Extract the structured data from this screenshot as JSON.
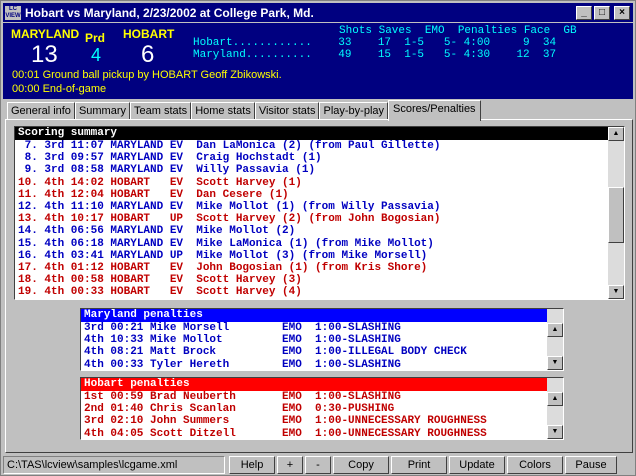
{
  "window": {
    "title": "Hobart vs Maryland, 2/23/2002 at College Park, Md.",
    "icon_text": "LC VIEW",
    "controls": [
      "_",
      "□",
      "×"
    ]
  },
  "scoreboard": {
    "home": {
      "name": "MARYLAND",
      "score": "13"
    },
    "visitor": {
      "name": "HOBART",
      "score": "6"
    },
    "period_label": "Prd",
    "period": "4",
    "stats_header": "Shots Saves  EMO  Penalties Face  GB",
    "stats_rows": [
      "Hobart............    33    17  1-5   5- 4:00     9  34",
      "Maryland..........    49    15  1-5   5- 4:30    12  37"
    ],
    "play_lines": [
      "00:01  Ground ball pickup by HOBART Geoff Zbikowski.",
      "00:00  End-of-game"
    ]
  },
  "tabs": [
    {
      "label": "General info",
      "active": false
    },
    {
      "label": "Summary",
      "active": false
    },
    {
      "label": "Team stats",
      "active": false
    },
    {
      "label": "Home stats",
      "active": false
    },
    {
      "label": "Visitor stats",
      "active": false
    },
    {
      "label": "Play-by-play",
      "active": false
    },
    {
      "label": "Scores/Penalties",
      "active": true
    }
  ],
  "scoring": {
    "header": "Scoring summary",
    "rows": [
      {
        "text": " 7. 3rd 11:07 MARYLAND EV  Dan LaMonica (2) (from Paul Gillette)",
        "team": "blue"
      },
      {
        "text": " 8. 3rd 09:57 MARYLAND EV  Craig Hochstadt (1)",
        "team": "blue"
      },
      {
        "text": " 9. 3rd 08:58 MARYLAND EV  Willy Passavia (1)",
        "team": "blue"
      },
      {
        "text": "10. 4th 14:02 HOBART   EV  Scott Harvey (1)",
        "team": "red"
      },
      {
        "text": "11. 4th 12:04 HOBART   EV  Dan Cesere (1)",
        "team": "red"
      },
      {
        "text": "12. 4th 11:10 MARYLAND EV  Mike Mollot (1) (from Willy Passavia)",
        "team": "blue"
      },
      {
        "text": "13. 4th 10:17 HOBART   UP  Scott Harvey (2) (from John Bogosian)",
        "team": "red"
      },
      {
        "text": "14. 4th 06:56 MARYLAND EV  Mike Mollot (2)",
        "team": "blue"
      },
      {
        "text": "15. 4th 06:18 MARYLAND EV  Mike LaMonica (1) (from Mike Mollot)",
        "team": "blue"
      },
      {
        "text": "16. 4th 03:41 MARYLAND UP  Mike Mollot (3) (from Mike Morsell)",
        "team": "blue"
      },
      {
        "text": "17. 4th 01:12 HOBART   EV  John Bogosian (1) (from Kris Shore)",
        "team": "red"
      },
      {
        "text": "18. 4th 00:58 HOBART   EV  Scott Harvey (3)",
        "team": "red"
      },
      {
        "text": "19. 4th 00:33 HOBART   EV  Scott Harvey (4)",
        "team": "red"
      }
    ]
  },
  "maryland_penalties": {
    "header": "Maryland penalties",
    "rows": [
      "3rd 00:21 Mike Morsell        EMO  1:00-SLASHING",
      "4th 10:33 Mike Mollot         EMO  1:00-SLASHING",
      "4th 08:21 Matt Brock          EMO  1:00-ILLEGAL BODY CHECK",
      "4th 00:33 Tyler Hereth        EMO  1:00-SLASHING"
    ]
  },
  "hobart_penalties": {
    "header": "Hobart penalties",
    "rows": [
      "1st 00:59 Brad Neuberth       EMO  1:00-SLASHING",
      "2nd 01:40 Chris Scanlan       EMO  0:30-PUSHING",
      "3rd 02:10 John Summers        EMO  1:00-UNNECESSARY ROUGHNESS",
      "4th 04:05 Scott Ditzell       EMO  1:00-UNNECESSARY ROUGHNESS"
    ]
  },
  "statusbar": {
    "path": "C:\\TAS\\lcview\\samples\\lcgame.xml",
    "buttons": {
      "help": "Help",
      "plus": "+",
      "minus": "-",
      "copy": "Copy",
      "print": "Print",
      "update": "Update",
      "colors": "Colors",
      "pause": "Pause"
    }
  },
  "colors": {
    "scoreboard_bg": "#000080",
    "maryland": "#0000c0",
    "hobart": "#c00000",
    "maryland_header": "#0000ff",
    "hobart_header": "#ff0000"
  }
}
